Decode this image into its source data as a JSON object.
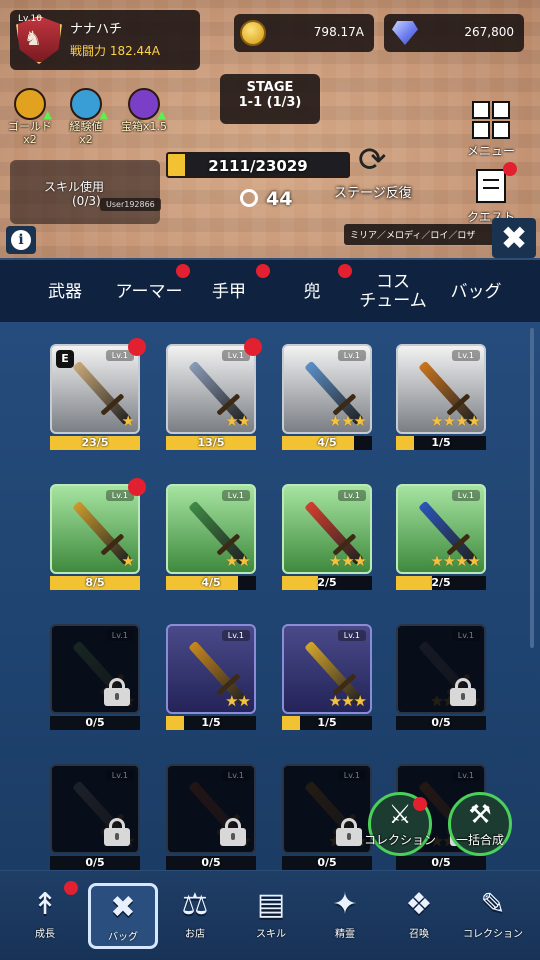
{
  "player": {
    "level": "Lv.10",
    "name": "ナナハチ",
    "power": "戦闘力 182.44A"
  },
  "currency": {
    "gold": "798.17A",
    "gems": "267,800"
  },
  "stage": {
    "title": "STAGE",
    "sub": "1-1 (1/3)"
  },
  "buffs": [
    {
      "label": "ゴールド",
      "mult": "x2",
      "color": "#e0a21f",
      "icon": "gold-buff-icon"
    },
    {
      "label": "経験値",
      "mult": "x2",
      "color": "#3a9ed6",
      "icon": "exp-buff-icon"
    },
    {
      "label": "宝箱x1.5",
      "mult": "",
      "color": "#7a3fc6",
      "icon": "chest-buff-icon"
    }
  ],
  "skill": {
    "label": "スキル使用",
    "count": "(0/3)"
  },
  "user_tag": "User192866",
  "boss_hp": {
    "text": "2111/23029",
    "fraction": 0.092
  },
  "timer": "44",
  "repeat_label": "ステージ反復",
  "side": {
    "menu": "メニュー",
    "quest": "クエスト"
  },
  "party_tag": "ミリア／メロディ／ロイ／ロザ",
  "tabs": [
    {
      "label": "武器",
      "dot": false
    },
    {
      "label": "アーマー",
      "dot": true
    },
    {
      "label": "手甲",
      "dot": true
    },
    {
      "label": "兜",
      "dot": true
    },
    {
      "label": "コス\nチューム",
      "dot": false
    },
    {
      "label": "バッグ",
      "dot": false
    }
  ],
  "weapons": [
    {
      "lv": "Lv.1",
      "progress": "23/5",
      "fill": 1.0,
      "stars": 1,
      "rarity": "gray",
      "badge": "E",
      "dot": true,
      "locked": false,
      "color": "#c9a879"
    },
    {
      "lv": "Lv.1",
      "progress": "13/5",
      "fill": 1.0,
      "stars": 2,
      "rarity": "gray",
      "badge": "",
      "dot": true,
      "locked": false,
      "color": "#8a9bb6"
    },
    {
      "lv": "Lv.1",
      "progress": "4/5",
      "fill": 0.8,
      "stars": 3,
      "rarity": "gray",
      "badge": "",
      "dot": false,
      "locked": false,
      "color": "#5b8fc7"
    },
    {
      "lv": "Lv.1",
      "progress": "1/5",
      "fill": 0.2,
      "stars": 4,
      "rarity": "gray",
      "badge": "",
      "dot": false,
      "locked": false,
      "color": "#c9741f"
    },
    {
      "lv": "Lv.1",
      "progress": "8/5",
      "fill": 1.0,
      "stars": 1,
      "rarity": "green",
      "badge": "",
      "dot": true,
      "locked": false,
      "color": "#c99a2e"
    },
    {
      "lv": "Lv.1",
      "progress": "4/5",
      "fill": 0.8,
      "stars": 2,
      "rarity": "green",
      "badge": "",
      "dot": false,
      "locked": false,
      "color": "#3f8a45"
    },
    {
      "lv": "Lv.1",
      "progress": "2/5",
      "fill": 0.4,
      "stars": 3,
      "rarity": "green",
      "badge": "",
      "dot": false,
      "locked": false,
      "color": "#d1402e"
    },
    {
      "lv": "Lv.1",
      "progress": "2/5",
      "fill": 0.4,
      "stars": 4,
      "rarity": "green",
      "badge": "",
      "dot": false,
      "locked": false,
      "color": "#2b55b8"
    },
    {
      "lv": "Lv.1",
      "progress": "0/5",
      "fill": 0.0,
      "stars": 1,
      "rarity": "locked",
      "badge": "",
      "dot": false,
      "locked": true,
      "color": "#2e4a34"
    },
    {
      "lv": "Lv.1",
      "progress": "1/5",
      "fill": 0.2,
      "stars": 2,
      "rarity": "purple",
      "badge": "",
      "dot": false,
      "locked": false,
      "color": "#c8871f"
    },
    {
      "lv": "Lv.1",
      "progress": "1/5",
      "fill": 0.2,
      "stars": 3,
      "rarity": "purple",
      "badge": "",
      "dot": false,
      "locked": false,
      "color": "#d3a52b"
    },
    {
      "lv": "Lv.1",
      "progress": "0/5",
      "fill": 0.0,
      "stars": 4,
      "rarity": "locked",
      "badge": "",
      "dot": false,
      "locked": true,
      "color": "#2b2f3a"
    },
    {
      "lv": "Lv.1",
      "progress": "0/5",
      "fill": 0.0,
      "stars": 1,
      "rarity": "locked",
      "badge": "",
      "dot": false,
      "locked": true,
      "color": "#3a3f44"
    },
    {
      "lv": "Lv.1",
      "progress": "0/5",
      "fill": 0.0,
      "stars": 2,
      "rarity": "locked",
      "badge": "",
      "dot": false,
      "locked": true,
      "color": "#4a2418"
    },
    {
      "lv": "Lv.1",
      "progress": "0/5",
      "fill": 0.0,
      "stars": 3,
      "rarity": "locked",
      "badge": "",
      "dot": false,
      "locked": true,
      "color": "#4a3314"
    },
    {
      "lv": "Lv.1",
      "progress": "0/5",
      "fill": 0.0,
      "stars": 4,
      "rarity": "locked",
      "badge": "",
      "dot": false,
      "locked": true,
      "color": "#4a2a14"
    }
  ],
  "fabs": {
    "collection": "コレクション",
    "combine": "一括合成"
  },
  "nav": [
    {
      "label": "成長",
      "icon": "growth-icon",
      "glyph": "↟",
      "dot": true,
      "active": false
    },
    {
      "label": "バッグ",
      "icon": "bag-icon",
      "glyph": "✖",
      "dot": false,
      "active": true
    },
    {
      "label": "お店",
      "icon": "shop-icon",
      "glyph": "⚖",
      "dot": false,
      "active": false
    },
    {
      "label": "スキル",
      "icon": "skill-book-icon",
      "glyph": "▤",
      "dot": false,
      "active": false
    },
    {
      "label": "精霊",
      "icon": "spirit-icon",
      "glyph": "✦",
      "dot": false,
      "active": false
    },
    {
      "label": "召喚",
      "icon": "summon-icon",
      "glyph": "❖",
      "dot": false,
      "active": false
    },
    {
      "label": "コレクション",
      "icon": "collection-icon",
      "glyph": "✎",
      "dot": false,
      "active": false
    }
  ]
}
